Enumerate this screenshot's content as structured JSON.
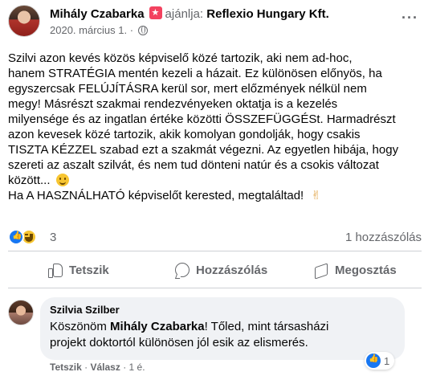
{
  "post": {
    "author": "Mihály Czabarka",
    "recommend_text": "ajánlja:",
    "recommended_page": "Reflexio Hungary Kft.",
    "date": "2020. március 1.",
    "separator": "·",
    "more_label": "···",
    "body_lines": [
      "Szilvi azon kevés közös képviselő közé tartozik, aki nem ad-hoc,",
      "hanem STRATÉGIA mentén kezeli a házait. Ez különösen előnyös, ha",
      "egyszercsak FELÚJÍTÁSRA kerül sor, mert előzmények nélkül nem",
      "megy! Másrészt szakmai rendezvényeken oktatja is a kezelés",
      "milyensége és az ingatlan értéke közötti ÖSSZEFÜGGÉSt. Harmadrészt",
      "azon kevesek közé tartozik, akik komolyan gondolják, hogy csakis",
      "TISZTA KÉZZEL szabad ezt a szakmát végezni. Az egyetlen hibája, hogy",
      "szereti az aszalt szilvát, és nem tud dönteni natúr és a csokis változat",
      "között... ",
      "Ha A HASZNÁLHATÓ  képviselőt kerested, megtaláltad! "
    ],
    "victory_emoji": "✌",
    "reaction_count": "3",
    "comment_count": "1 hozzászólás"
  },
  "actions": {
    "like": "Tetszik",
    "comment": "Hozzászólás",
    "share": "Megosztás"
  },
  "comment": {
    "author": "Szilvia Szilber",
    "text_line1_prefix": "Köszönöm ",
    "text_line1_mention": "Mihály Czabarka",
    "text_line1_suffix": "! Tőled, mint társasházi",
    "text_line2": "projekt doktortól különösen jól esik az elismerés.",
    "reaction_count": "1",
    "like_action": "Tetszik",
    "dot": "·",
    "reply_action": "Válasz",
    "time": "1 é."
  }
}
